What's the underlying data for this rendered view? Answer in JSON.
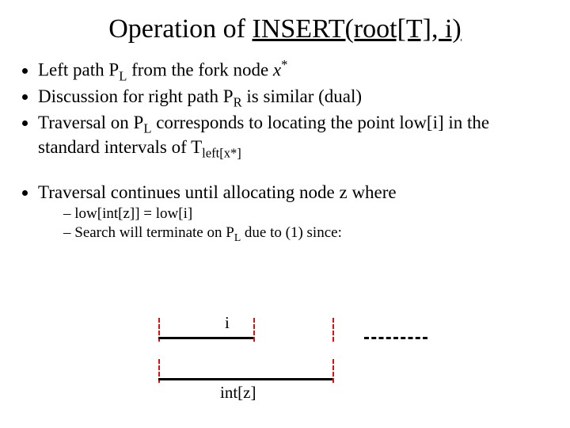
{
  "title": {
    "pre": "Operation of ",
    "underlined": "INSERT(root[T], i)"
  },
  "bullets1": {
    "b1": {
      "t1": "Left path P",
      "sub1": "L",
      "t2": " from the fork node ",
      "xvar": "x",
      "sup": "*"
    },
    "b2": {
      "t1": "Discussion for right path P",
      "sub1": "R",
      "t2": " is similar (dual)"
    },
    "b3": {
      "t1": "Traversal on P",
      "sub1": "L",
      "t2": " corresponds to locating the point low[i] in the standard intervals of T",
      "sub2": "left[x*]"
    }
  },
  "bullets2": {
    "b1": "Traversal continues until allocating node z where",
    "s1": "low[int[z]] = low[i]",
    "s2": {
      "t1": "Search will terminate on P",
      "sub1": "L",
      "t2": " due to (1) since:"
    }
  },
  "diagram": {
    "label_i": "i",
    "label_intz": "int[z]"
  }
}
